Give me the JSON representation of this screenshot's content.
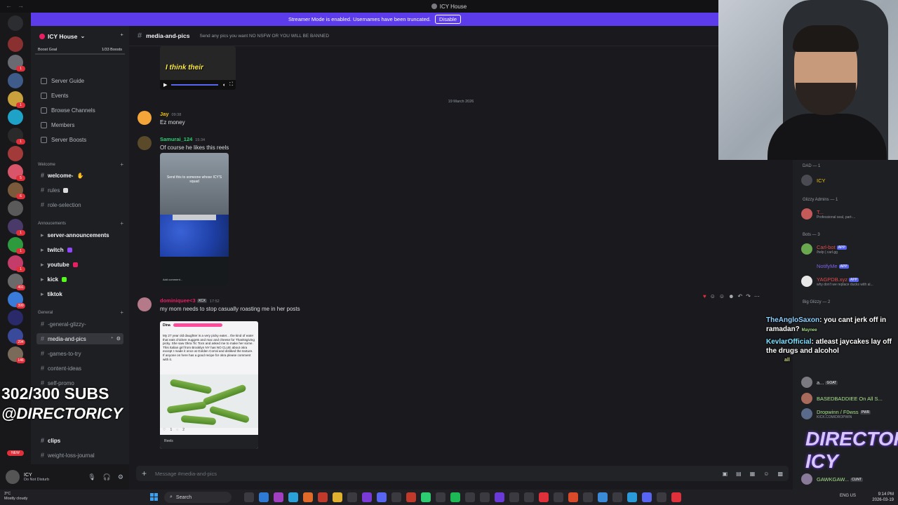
{
  "window": {
    "title": "ICY House"
  },
  "banner": {
    "text": "Streamer Mode is enabled. Usernames have been truncated.",
    "button": "Disable"
  },
  "server": {
    "name": "ICY House",
    "boost_goal": "Boost Goal",
    "boost_count": "1/33 Boosts"
  },
  "rail_badges": [
    "1",
    "1",
    "1",
    "5",
    "6",
    "1",
    "1",
    "1",
    "491",
    "399",
    "294",
    "146",
    "NEW"
  ],
  "menu": [
    "Server Guide",
    "Events",
    "Browse Channels",
    "Members",
    "Server Boosts"
  ],
  "categories": {
    "welcome": "Welcome",
    "announcements": "Annoucements",
    "general": "General"
  },
  "channels": {
    "welcome": "welcome-",
    "rules": "rules",
    "role_selection": "role-selection",
    "server_announcements": "server-announcements",
    "twitch": "twitch",
    "youtube": "youtube",
    "kick": "kick",
    "tiktok": "tiktok",
    "general_glizzy": "-general-glizzy-",
    "media_and_pics": "media-and-pics",
    "games_to_try": "-games-to-try",
    "content_ideas": "content-ideas",
    "self_promo": "self-promo",
    "clips": "clips",
    "weight_loss_journal": "weight-loss-journal"
  },
  "overlay": {
    "subs": "302/300 SUBS",
    "handle": "@DIRECTORICY"
  },
  "user": {
    "name": "ICY",
    "status": "Do Not Disturb"
  },
  "header": {
    "channel": "media-and-pics",
    "topic": "Send any pics you want NO NSFW OR YOU WILL BE BANNED"
  },
  "date_divider": "19 March 2026",
  "top_media_caption": "I think their",
  "messages": [
    {
      "user": "Jay",
      "time": "09:38",
      "text": "Ez money",
      "color": "#f1c40f"
    },
    {
      "user": "Samurai_124",
      "time": "15:34",
      "text": "Of course he likes this reels",
      "color": "#2ecc71"
    },
    {
      "user": "dominiquee<3",
      "tag": "XCX",
      "time": "17:52",
      "text": "my mom needs to stop casually roasting me in her posts",
      "color": "#e91e63"
    }
  ],
  "reel": {
    "overlay_text": "Send this to someone whose ICY'S squad",
    "comment_placeholder": "Add comment..."
  },
  "post": {
    "header": "Dina",
    "body": "My 27 year old daughter is a very picky eater... the kind of eater that eats chicken nuggets and mac and cheese for Thanksgiving picky. She saw Okra Tic Tocs and asked me to make her some. This Italian girl from Brooklyn NY has NO CLUE about okra except I made it once at Golden Corral and disliked the texture. If anyone on here has a good recipe for okra please comment with it.",
    "footer_left": "1",
    "footer_mid": "2",
    "footer_bottom": "Reels"
  },
  "input": {
    "placeholder": "Message #media-and-pics"
  },
  "members": {
    "dad_header": "DAD — 1",
    "dad": "ICY",
    "admins_header": "Glizzy Admins — 1",
    "admin": "T...",
    "admin_sub": "Professional seal, part-...",
    "bots_header": "Bots — 3",
    "bots": [
      {
        "name": "Carl-bot",
        "sub": "/help | carl.gg",
        "color": "#e04b4b"
      },
      {
        "name": "NotifyMe",
        "sub": "",
        "color": "#7e63e8"
      },
      {
        "name": "YAGPDB.xyz",
        "sub": "why don't we replace ducks with al...",
        "color": "#e04b4b"
      }
    ],
    "big_header": "Big Glizzy — 2",
    "big": [
      {
        "name": "a...",
        "tag": "GOAT",
        "color": "#dbdee1"
      },
      {
        "name": "BASEDBADDIEE On All S...",
        "color": "#a7e08c"
      },
      {
        "name": "Dropwinn / F0wss",
        "tag": "PWR",
        "sub": "KICK.COM/DROPWIN",
        "color": "#a7e08c"
      },
      {
        "name": "GAWKGAW...",
        "tag": "CUNT",
        "color": "#a7e08c"
      }
    ]
  },
  "stream_chat": [
    {
      "user": "TheAngloSaxon",
      "text": ": you cant jerk off in ramadan?",
      "extra": "Maynee"
    },
    {
      "user": "KevlarOfficial",
      "text": ": atleast jaycakes lay off the drugs and alcohol",
      "extra": "all"
    }
  ],
  "logo": "DIRECTOR ICY",
  "taskbar": {
    "weather_temp": "3°C",
    "weather_text": "Mostly cloudy",
    "search": "Search",
    "lang": "ENG US",
    "time": "9:14 PM",
    "date": "2026-03-19"
  },
  "colors": {
    "accent": "#5b3bea",
    "active_channel": "#35373c",
    "bg": "#1a1a1e"
  }
}
